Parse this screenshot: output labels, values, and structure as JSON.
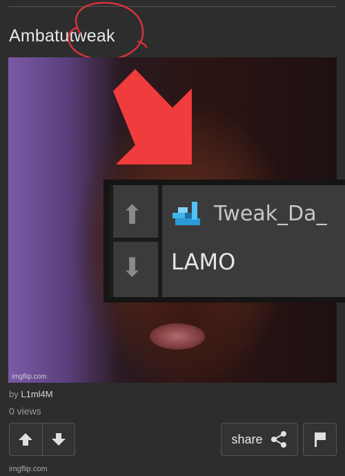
{
  "post": {
    "title": "Ambatutweak",
    "byline_prefix": "by",
    "author": "L1ml4M",
    "views": "0 views"
  },
  "meme": {
    "watermark": "imgflip.com",
    "inset": {
      "username": "Tweak_Da_",
      "comment": "LAMO"
    }
  },
  "actions": {
    "share_label": "share"
  },
  "footer": {
    "watermark": "imgflip.com"
  },
  "colors": {
    "background": "#2d2d2d",
    "scribble": "#d8323b",
    "arrow": "#f03c3c",
    "text": "#e8e8e8",
    "muted": "#9a9a9a"
  },
  "icons": [
    "upvote-icon",
    "downvote-icon",
    "share-icon",
    "flag-icon",
    "user-badge-icon"
  ]
}
